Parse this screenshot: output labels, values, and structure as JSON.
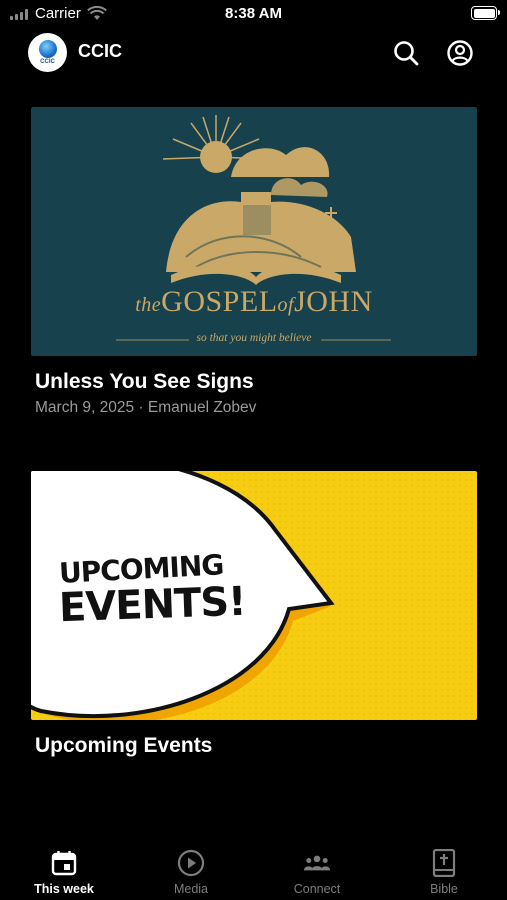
{
  "status_bar": {
    "carrier": "Carrier",
    "time": "8:38 AM"
  },
  "header": {
    "logo_text": "CCIC",
    "title": "CCIC",
    "search_icon": "search-icon",
    "profile_icon": "profile-icon"
  },
  "cards": [
    {
      "title": "Unless You See Signs",
      "meta": "March 9, 2025 · Emanuel Zobev",
      "image": {
        "title_prefix": "the",
        "title_main": "GOSPEL",
        "title_of": "of",
        "title_end": "JOHN",
        "subtitle": "so that you might believe",
        "bg_color": "#17414c",
        "art_color": "#c9a868"
      }
    },
    {
      "title": "Upcoming Events",
      "image": {
        "line1": "UPCOMING",
        "line2": "EVENTS!",
        "bg_color": "#f7cd14"
      }
    }
  ],
  "tabs": [
    {
      "label": "This week",
      "icon": "calendar-icon",
      "active": true
    },
    {
      "label": "Media",
      "icon": "play-icon",
      "active": false
    },
    {
      "label": "Connect",
      "icon": "group-icon",
      "active": false
    },
    {
      "label": "Bible",
      "icon": "bible-icon",
      "active": false
    }
  ]
}
